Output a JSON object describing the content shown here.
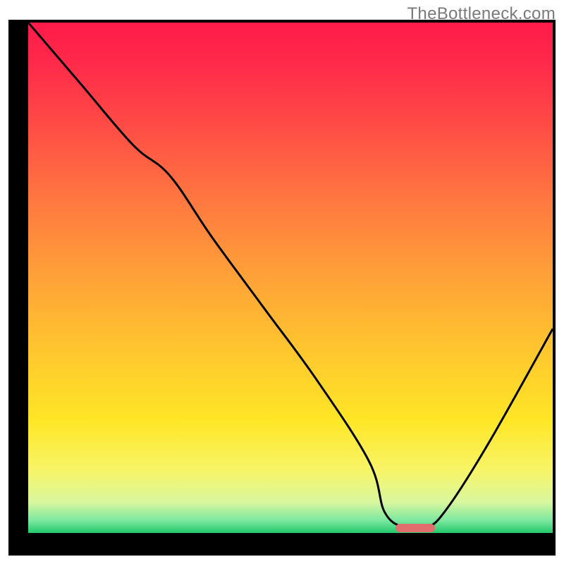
{
  "watermark": "TheBottleneck.com",
  "gradient": {
    "stops": [
      {
        "offset": 0.0,
        "color": "#ff1a4a"
      },
      {
        "offset": 0.08,
        "color": "#ff2a4a"
      },
      {
        "offset": 0.2,
        "color": "#ff4b46"
      },
      {
        "offset": 0.35,
        "color": "#ff7840"
      },
      {
        "offset": 0.5,
        "color": "#ffa238"
      },
      {
        "offset": 0.65,
        "color": "#ffc82e"
      },
      {
        "offset": 0.78,
        "color": "#ffe626"
      },
      {
        "offset": 0.88,
        "color": "#f7f56a"
      },
      {
        "offset": 0.94,
        "color": "#d8f79e"
      },
      {
        "offset": 0.975,
        "color": "#7de8a0"
      },
      {
        "offset": 1.0,
        "color": "#22c96b"
      }
    ]
  },
  "marker": {
    "x_frac": 0.7,
    "width_frac": 0.075
  },
  "chart_data": {
    "type": "line",
    "title": "",
    "xlabel": "",
    "ylabel": "",
    "ylim": [
      0,
      100
    ],
    "xlim": [
      0,
      100
    ],
    "x": [
      0,
      10,
      20,
      27,
      35,
      45,
      55,
      65,
      68,
      72,
      76,
      80,
      88,
      100
    ],
    "values": [
      100,
      88,
      76,
      70,
      58,
      44,
      30,
      14,
      4,
      1,
      1,
      5,
      18,
      40
    ],
    "optimal_region": {
      "x_start": 70,
      "x_end": 77.5
    },
    "annotations": []
  }
}
